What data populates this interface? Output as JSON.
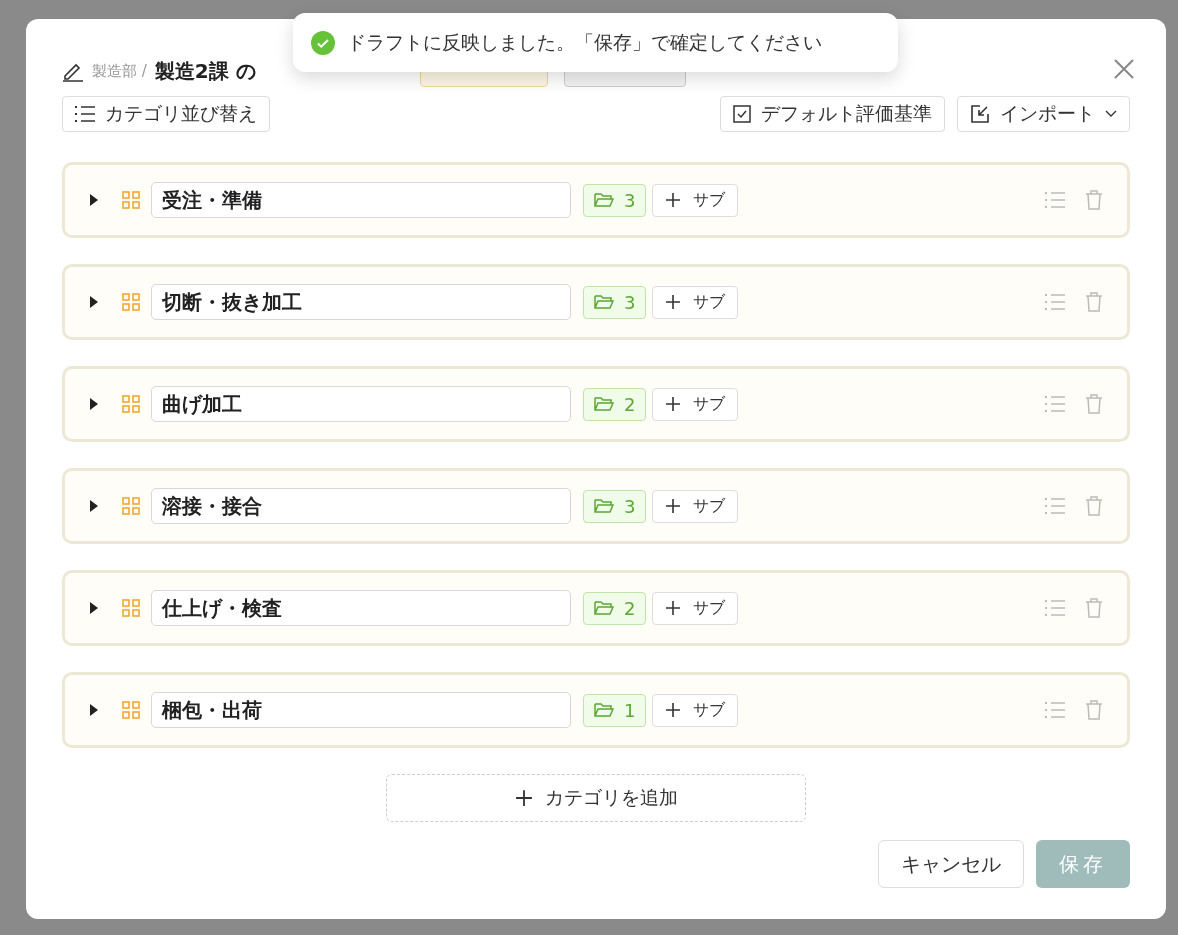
{
  "toast": {
    "message": "ドラフトに反映しました。「保存」で確定してください"
  },
  "dialog": {
    "breadcrumb": "製造部 /",
    "title": "製造2課 の",
    "badges": [
      {
        "kind": "category"
      },
      {
        "kind": "skill"
      }
    ]
  },
  "toolbar": {
    "reorder": "カテゴリ並び替え",
    "default_criteria": "デフォルト評価基準",
    "import": "インポート"
  },
  "categories": [
    {
      "name": "受注・準備",
      "count": "3",
      "sub": "サブ",
      "expanded": false
    },
    {
      "name": "切断・抜き加工",
      "count": "3",
      "sub": "サブ",
      "expanded": false
    },
    {
      "name": "曲げ加工",
      "count": "2",
      "sub": "サブ",
      "expanded": false
    },
    {
      "name": "溶接・接合",
      "count": "3",
      "sub": "サブ",
      "expanded": false
    },
    {
      "name": "仕上げ・検査",
      "count": "2",
      "sub": "サブ",
      "expanded": false
    },
    {
      "name": "梱包・出荷",
      "count": "1",
      "sub": "サブ",
      "expanded": false
    }
  ],
  "add_category": "カテゴリを追加",
  "buttons": [
    {
      "kind": "cancel",
      "label": "キャンセル"
    },
    {
      "kind": "save",
      "label": "保存"
    }
  ]
}
